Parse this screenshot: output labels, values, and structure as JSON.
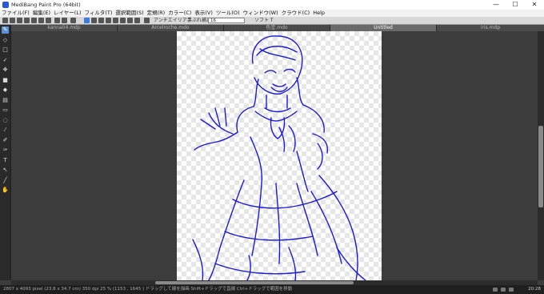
{
  "window": {
    "title": "MediBang Paint Pro (64bit)"
  },
  "window_controls": {
    "minimize": "—",
    "maximize": "☐",
    "close": "✕"
  },
  "menu": [
    "ファイル(F)",
    "編集(E)",
    "レイヤー(L)",
    "フィルタ(T)",
    "選択範囲(S)",
    "定規(R)",
    "カラー(C)",
    "表示(V)",
    "ツール(O)",
    "ウィンドウ(W)",
    "クラウド(C)",
    "Help"
  ],
  "toolbar": {
    "hint_label": "アンチエイリアス",
    "stabilizer_label": "手ぶれ補正",
    "stabilizer_value": "16",
    "right_hint": "ソフト T"
  },
  "tabs": [
    {
      "label": "kanna04.mdp",
      "active": false
    },
    {
      "label": "Arcelroche.mdo",
      "active": false
    },
    {
      "label": "色塗.mdo",
      "active": false
    },
    {
      "label": "Untitled",
      "active": true
    },
    {
      "label": "iris.mdp",
      "active": false
    }
  ],
  "tools": [
    {
      "name": "pen",
      "glyph": "✎",
      "active": true
    },
    {
      "name": "eraser",
      "glyph": "◇"
    },
    {
      "name": "dot",
      "glyph": "□"
    },
    {
      "name": "check",
      "glyph": "✓"
    },
    {
      "name": "move",
      "glyph": "✥"
    },
    {
      "name": "fill-rect",
      "glyph": "■"
    },
    {
      "name": "bucket",
      "glyph": "◆"
    },
    {
      "name": "gradient",
      "glyph": "▤"
    },
    {
      "name": "select-rect",
      "glyph": "▭"
    },
    {
      "name": "lasso",
      "glyph": "◌"
    },
    {
      "name": "wand",
      "glyph": "⁄"
    },
    {
      "name": "select-pen",
      "glyph": "✐"
    },
    {
      "name": "select-eraser",
      "glyph": "✑"
    },
    {
      "name": "text",
      "glyph": "T"
    },
    {
      "name": "operation",
      "glyph": "↖"
    },
    {
      "name": "eyedropper",
      "glyph": "╱"
    },
    {
      "name": "hand",
      "glyph": "✋"
    }
  ],
  "status": {
    "text": "2807 x 4093 pixel   (23.8 x 34.7 cm)   350 dpi   25 %   (1153 , 1645 )   ドラッグして線を描画 Shift+ドラッグで直線 Ctrl+ドラッグで範囲を移動",
    "clock": "20:28"
  },
  "colors": {
    "line_art": "#1a1ad6",
    "accent": "#5b8fd8"
  }
}
